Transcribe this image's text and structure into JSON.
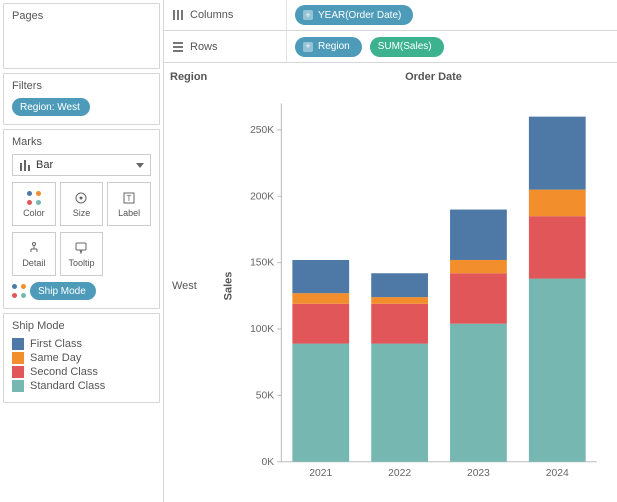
{
  "sidebar": {
    "pages_title": "Pages",
    "filters_title": "Filters",
    "filter_pill": "Region: West",
    "marks_title": "Marks",
    "mark_type": "Bar",
    "mark_buttons": [
      "Color",
      "Size",
      "Label",
      "Detail",
      "Tooltip"
    ],
    "ship_pill": "Ship Mode",
    "legend_title": "Ship Mode",
    "legend_items": [
      {
        "label": "First Class",
        "color": "#4e79a7"
      },
      {
        "label": "Same Day",
        "color": "#f28e2b"
      },
      {
        "label": "Second Class",
        "color": "#e15759"
      },
      {
        "label": "Standard Class",
        "color": "#76b7b2"
      }
    ]
  },
  "shelves": {
    "columns_label": "Columns",
    "rows_label": "Rows",
    "columns_pills": [
      "YEAR(Order Date)"
    ],
    "rows_pills": [
      {
        "text": "Region",
        "type": "blue"
      },
      {
        "text": "SUM(Sales)",
        "type": "green"
      }
    ]
  },
  "viz": {
    "region_hdr": "Region",
    "orderdate_hdr": "Order Date",
    "row_value": "West",
    "y_axis_label": "Sales"
  },
  "chart_data": {
    "type": "bar",
    "stacked": true,
    "categories": [
      "2021",
      "2022",
      "2023",
      "2024"
    ],
    "series": [
      {
        "name": "Standard Class",
        "color": "#76b7b2",
        "values": [
          89000,
          89000,
          104000,
          138000
        ]
      },
      {
        "name": "Second Class",
        "color": "#e15759",
        "values": [
          30000,
          30000,
          38000,
          47000
        ]
      },
      {
        "name": "Same Day",
        "color": "#f28e2b",
        "values": [
          8000,
          5000,
          10000,
          20000
        ]
      },
      {
        "name": "First Class",
        "color": "#4e79a7",
        "values": [
          25000,
          18000,
          38000,
          55000
        ]
      }
    ],
    "ylim": [
      0,
      270000
    ],
    "yticks": [
      0,
      50000,
      100000,
      150000,
      200000,
      250000
    ],
    "ytick_labels": [
      "0K",
      "50K",
      "100K",
      "150K",
      "200K",
      "250K"
    ],
    "xlabel": "",
    "ylabel": "Sales",
    "title": ""
  }
}
